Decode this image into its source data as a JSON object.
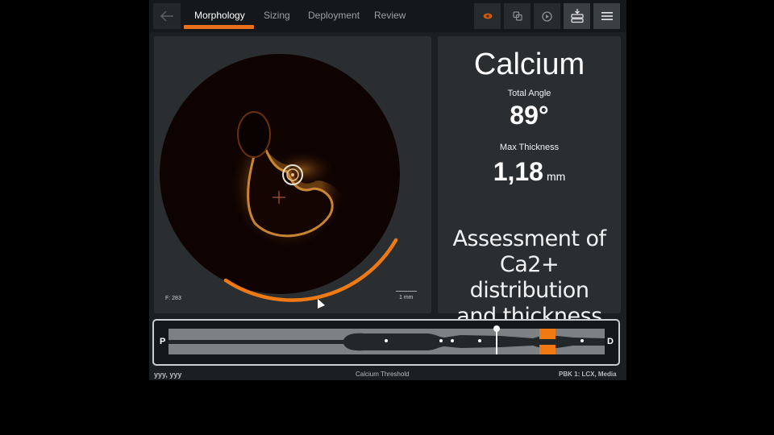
{
  "topbar": {
    "back_icon": "arrow-left-icon",
    "tabs": [
      {
        "label": "Morphology",
        "active": true
      },
      {
        "label": "Sizing",
        "active": false
      },
      {
        "label": "Deployment",
        "active": false
      },
      {
        "label": "Review",
        "active": false
      }
    ],
    "tools": [
      {
        "icon": "eye-icon"
      },
      {
        "icon": "copy-layers-icon"
      },
      {
        "icon": "play-icon"
      },
      {
        "icon": "download-stack-icon"
      },
      {
        "icon": "menu-icon"
      }
    ],
    "accent": "#e8711d"
  },
  "image_panel": {
    "frame_label": "F: 283",
    "scale_label": "1 mm"
  },
  "calcium_panel": {
    "title": "Calcium",
    "total_angle_label": "Total Angle",
    "total_angle_value": "89°",
    "max_thickness_label": "Max Thickness",
    "max_thickness_value": "1,18",
    "max_thickness_unit": "mm",
    "assessment_lines": [
      "Assessment of",
      "Ca2+ distribution",
      "and thickness"
    ]
  },
  "longitudinal_view": {
    "proximal_label": "P",
    "distal_label": "D",
    "calcium_highlight_color": "#ef7a14"
  },
  "footer": {
    "left_text": "yyy, yyy",
    "center_text": "Calcium Threshold",
    "right_text": "PBK 1:  LCX,  Media"
  }
}
